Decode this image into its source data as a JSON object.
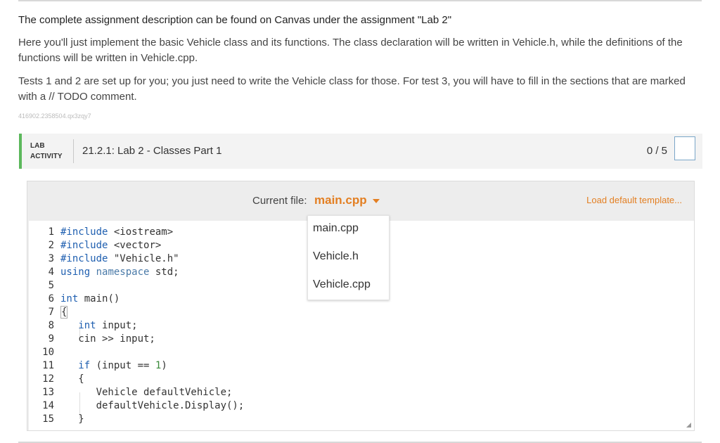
{
  "intro": {
    "heading": "The complete assignment description can be found on Canvas under the assignment \"Lab 2\"",
    "paragraph1": "Here you'll just implement the basic Vehicle class and its functions. The class declaration will be written in Vehicle.h, while the definitions of the functions will be written in Vehicle.cpp.",
    "paragraph2": "Tests 1 and 2 are set up for you; you just need to write the Vehicle class for those. For test 3, you will have to fill in the sections that are marked with a // TODO comment.",
    "watermark": "416902.2358504.qx3zqy7"
  },
  "lab": {
    "tag_line1": "LAB",
    "tag_line2": "ACTIVITY",
    "title": "21.2.1: Lab 2 - Classes Part 1",
    "score": "0 / 5",
    "accent_color": "#5cb85c"
  },
  "editor": {
    "current_file_label": "Current file:",
    "current_file": "main.cpp",
    "load_default": "Load default template...",
    "files": [
      "main.cpp",
      "Vehicle.h",
      "Vehicle.cpp"
    ],
    "accent_color": "#e37f22",
    "lines": [
      {
        "n": "1",
        "t": "#include <iostream>"
      },
      {
        "n": "2",
        "t": "#include <vector>"
      },
      {
        "n": "3",
        "t": "#include \"Vehicle.h\""
      },
      {
        "n": "4",
        "t": "using namespace std;"
      },
      {
        "n": "5",
        "t": ""
      },
      {
        "n": "6",
        "t": "int main()"
      },
      {
        "n": "7",
        "t": "{"
      },
      {
        "n": "8",
        "t": "   int input;"
      },
      {
        "n": "9",
        "t": "   cin >> input;"
      },
      {
        "n": "10",
        "t": ""
      },
      {
        "n": "11",
        "t": "   if (input == 1)"
      },
      {
        "n": "12",
        "t": "   {"
      },
      {
        "n": "13",
        "t": "      Vehicle defaultVehicle;"
      },
      {
        "n": "14",
        "t": "      defaultVehicle.Display();"
      },
      {
        "n": "15",
        "t": "   }"
      }
    ]
  }
}
